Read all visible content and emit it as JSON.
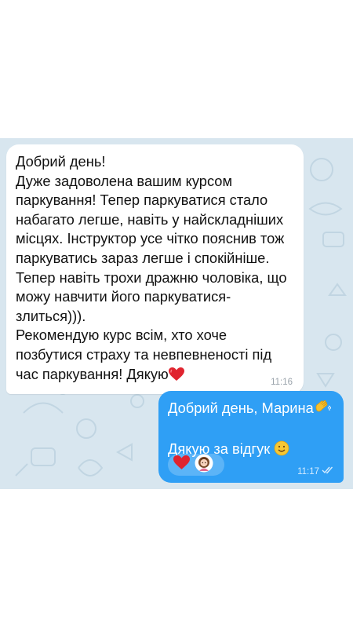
{
  "incoming_message": {
    "lines": [
      "Добрий день!",
      "Дуже задоволена вашим курсом",
      "паркування! Тепер паркуватися стало",
      "набагато легше, навіть у найскладніших",
      "місцях. Інструктор усе чітко пояснив тож",
      "паркуватись зараз легше і спокійніше.",
      "Тепер навіть трохи дражню чоловіка, що",
      "можу навчити його паркуватися-",
      "злиться))).",
      "Рекомендую курс всім, хто хоче",
      "позбутися страху та невпевненості під",
      "час паркування! Дякую"
    ],
    "time": "11:16",
    "trailing_emoji": "heart-icon"
  },
  "outgoing_message": {
    "line1": "Добрий день, Марина",
    "line1_emoji": "waving-hand-icon",
    "line2": "Дякую за відгук",
    "line2_emoji": "smiling-face-icon",
    "time": "11:17",
    "status": "double-check-icon",
    "reactions": [
      "heart-icon",
      "avatar"
    ]
  },
  "colors": {
    "chat_background": "#d8e6ef",
    "incoming_bubble": "#ffffff",
    "outgoing_bubble": "#2f9ff5",
    "heart": "#e0242f"
  }
}
